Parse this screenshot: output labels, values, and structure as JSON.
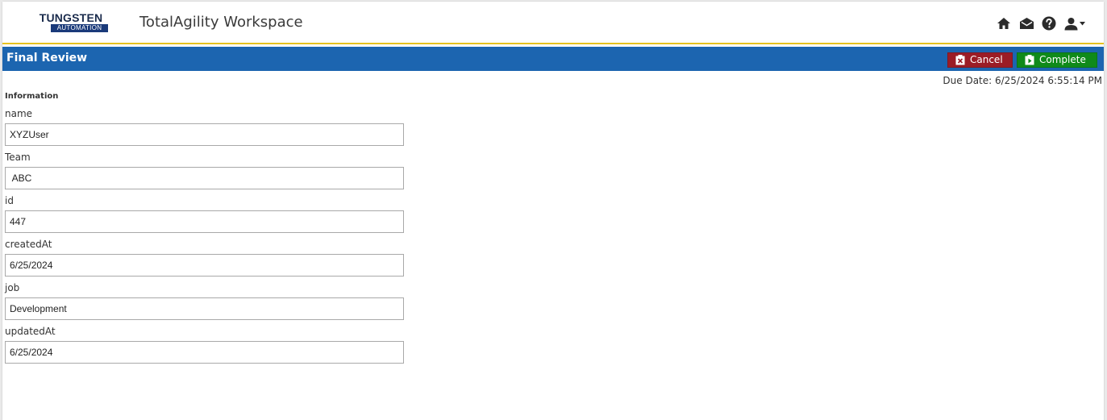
{
  "header": {
    "logo_top": "TUNGSTEN",
    "logo_bottom": "AUTOMATION",
    "app_title": "TotalAgility Workspace",
    "icons": [
      "home-icon",
      "inbox-icon",
      "help-icon",
      "user-icon",
      "caret-down-icon"
    ]
  },
  "titlebar": {
    "title": "Final Review",
    "cancel_label": "Cancel",
    "complete_label": "Complete"
  },
  "due_date": "Due Date: 6/25/2024 6:55:14 PM",
  "section_label": "Information",
  "fields": [
    {
      "label": "name",
      "value": "XYZUser"
    },
    {
      "label": "Team",
      "value": " ABC"
    },
    {
      "label": "id",
      "value": "447"
    },
    {
      "label": "createdAt",
      "value": "6/25/2024"
    },
    {
      "label": "job",
      "value": "Development"
    },
    {
      "label": "updatedAt",
      "value": "6/25/2024"
    }
  ],
  "colors": {
    "title_bar": "#1c65b0",
    "header_underline": "#e6c21f",
    "cancel_button": "#9b1c26",
    "complete_button": "#0f8a1a"
  }
}
